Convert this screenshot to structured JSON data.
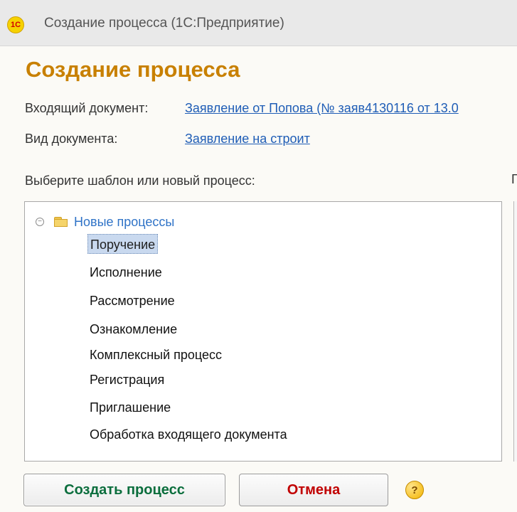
{
  "window": {
    "icon_text": "1С",
    "title": "Создание процесса  (1С:Предприятие)"
  },
  "form": {
    "title": "Создание процесса",
    "incoming_document_label": "Входящий документ:",
    "incoming_document_value": "Заявление от Попова (№ заяв4130116 от 13.0",
    "document_type_label": "Вид документа:",
    "document_type_value": "Заявление на строит",
    "template_prompt": "Выберите шаблон или новый процесс:",
    "side_caption": "Г"
  },
  "tree": {
    "root_label": "Новые процессы",
    "items": [
      {
        "label": "Поручение",
        "selected": true
      },
      {
        "label": "Исполнение",
        "selected": false
      },
      {
        "label": "Рассмотрение",
        "selected": false
      },
      {
        "label": "Ознакомление",
        "selected": false
      },
      {
        "label": "Комплексный процесс",
        "selected": false
      },
      {
        "label": "Регистрация",
        "selected": false
      },
      {
        "label": "Приглашение",
        "selected": false
      },
      {
        "label": "Обработка входящего документа",
        "selected": false
      }
    ]
  },
  "buttons": {
    "create": "Создать процесс",
    "cancel": "Отмена",
    "help": "?"
  }
}
